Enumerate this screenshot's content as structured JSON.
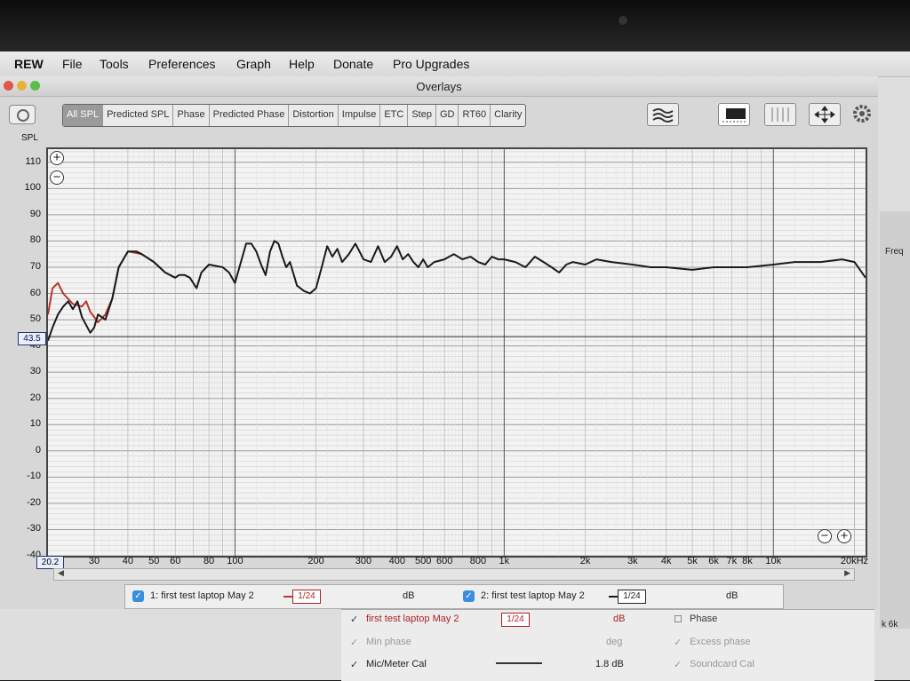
{
  "menubar": {
    "items": [
      "REW",
      "File",
      "Tools",
      "Preferences",
      "Graph",
      "Help",
      "Donate",
      "Pro Upgrades"
    ]
  },
  "window": {
    "title": "Overlays"
  },
  "toolbar": {
    "tabs": [
      "All SPL",
      "Predicted SPL",
      "Phase",
      "Predicted Phase",
      "Distortion",
      "Impulse",
      "ETC",
      "Step",
      "GD",
      "RT60",
      "Clarity"
    ],
    "active_tab": "All SPL",
    "tool_icons": [
      "waterfall-icon",
      "controls-icon",
      "limits-icon",
      "fit-icon",
      "settings-gear-icon"
    ]
  },
  "side": {
    "freq_label": "Freq",
    "bottom_label": "k 6k"
  },
  "legend": {
    "items": [
      {
        "label": "1: first test laptop May 2",
        "smoothing": "1/24",
        "unit": "dB",
        "color": "#b5382e"
      },
      {
        "label": "2: first test laptop May 2",
        "smoothing": "1/24",
        "unit": "dB",
        "color": "#1a1a1a"
      }
    ]
  },
  "panel": {
    "rows": [
      {
        "label": "first test laptop May 2",
        "smoothing": "1/24",
        "unit": "dB",
        "right": "Phase"
      },
      {
        "label": "Min phase",
        "smoothing": "",
        "unit": "deg",
        "right": "Excess phase"
      },
      {
        "label": "Mic/Meter Cal",
        "smoothing": "",
        "unit": "1.8 dB",
        "right": "Soundcard Cal"
      }
    ]
  },
  "chart_data": {
    "type": "line",
    "ylabel": "SPL",
    "ylim": [
      -40,
      115
    ],
    "xlim": [
      20.2,
      22000
    ],
    "x_scale": "log",
    "y_ticks": [
      110,
      100,
      90,
      80,
      70,
      60,
      50,
      40,
      30,
      20,
      10,
      0,
      -10,
      -20,
      -30,
      -40
    ],
    "x_ticks": [
      {
        "v": 30,
        "label": "30"
      },
      {
        "v": 40,
        "label": "40"
      },
      {
        "v": 50,
        "label": "50"
      },
      {
        "v": 60,
        "label": "60"
      },
      {
        "v": 80,
        "label": "80"
      },
      {
        "v": 100,
        "label": "100"
      },
      {
        "v": 200,
        "label": "200"
      },
      {
        "v": 300,
        "label": "300"
      },
      {
        "v": 400,
        "label": "400"
      },
      {
        "v": 500,
        "label": "500"
      },
      {
        "v": 600,
        "label": "600"
      },
      {
        "v": 800,
        "label": "800"
      },
      {
        "v": 1000,
        "label": "1k"
      },
      {
        "v": 2000,
        "label": "2k"
      },
      {
        "v": 3000,
        "label": "3k"
      },
      {
        "v": 4000,
        "label": "4k"
      },
      {
        "v": 5000,
        "label": "5k"
      },
      {
        "v": 6000,
        "label": "6k"
      },
      {
        "v": 7000,
        "label": "7k"
      },
      {
        "v": 8000,
        "label": "8k"
      },
      {
        "v": 10000,
        "label": "10k"
      },
      {
        "v": 20000,
        "label": "20kHz"
      }
    ],
    "x_start_label": "20.2",
    "cursor_y": 43.5,
    "cursor_label": "43.5",
    "grid": true,
    "series": [
      {
        "name": "1: first test laptop May 2",
        "color": "#b5382e",
        "points": [
          [
            20.2,
            52
          ],
          [
            21,
            62
          ],
          [
            22,
            64
          ],
          [
            23,
            60
          ],
          [
            25,
            56
          ],
          [
            27,
            55
          ],
          [
            28,
            57
          ],
          [
            29,
            53
          ],
          [
            31,
            49
          ],
          [
            33,
            52
          ],
          [
            35,
            58
          ],
          [
            37,
            70
          ],
          [
            40,
            76
          ],
          [
            45,
            75
          ],
          [
            50,
            72
          ],
          [
            55,
            68
          ],
          [
            60,
            66
          ]
        ]
      },
      {
        "name": "2: first test laptop May 2",
        "color": "#1a1a1a",
        "points": [
          [
            20.2,
            42
          ],
          [
            21,
            47
          ],
          [
            22,
            52
          ],
          [
            23,
            55
          ],
          [
            24,
            57
          ],
          [
            25,
            54
          ],
          [
            26,
            57
          ],
          [
            27,
            51
          ],
          [
            29,
            45
          ],
          [
            30,
            47
          ],
          [
            31,
            52
          ],
          [
            33,
            50
          ],
          [
            35,
            58
          ],
          [
            37,
            70
          ],
          [
            40,
            76
          ],
          [
            43,
            76
          ],
          [
            45,
            75
          ],
          [
            50,
            72
          ],
          [
            55,
            68
          ],
          [
            60,
            66
          ],
          [
            62,
            67
          ],
          [
            65,
            67
          ],
          [
            68,
            66
          ],
          [
            72,
            62
          ],
          [
            75,
            68
          ],
          [
            80,
            71
          ],
          [
            90,
            70
          ],
          [
            95,
            68
          ],
          [
            100,
            64
          ],
          [
            110,
            79
          ],
          [
            115,
            79
          ],
          [
            120,
            76
          ],
          [
            125,
            71
          ],
          [
            130,
            67
          ],
          [
            135,
            76
          ],
          [
            140,
            80
          ],
          [
            145,
            79
          ],
          [
            150,
            74
          ],
          [
            155,
            70
          ],
          [
            160,
            72
          ],
          [
            170,
            63
          ],
          [
            180,
            61
          ],
          [
            190,
            60
          ],
          [
            200,
            62
          ],
          [
            210,
            70
          ],
          [
            220,
            78
          ],
          [
            230,
            74
          ],
          [
            240,
            77
          ],
          [
            250,
            72
          ],
          [
            265,
            75
          ],
          [
            280,
            79
          ],
          [
            290,
            76
          ],
          [
            300,
            73
          ],
          [
            320,
            72
          ],
          [
            340,
            78
          ],
          [
            360,
            72
          ],
          [
            380,
            74
          ],
          [
            400,
            78
          ],
          [
            420,
            73
          ],
          [
            440,
            75
          ],
          [
            460,
            72
          ],
          [
            480,
            70
          ],
          [
            500,
            73
          ],
          [
            520,
            70
          ],
          [
            550,
            72
          ],
          [
            600,
            73
          ],
          [
            650,
            75
          ],
          [
            700,
            73
          ],
          [
            750,
            74
          ],
          [
            800,
            72
          ],
          [
            850,
            71
          ],
          [
            900,
            74
          ],
          [
            950,
            73
          ],
          [
            1000,
            73
          ],
          [
            1100,
            72
          ],
          [
            1200,
            70
          ],
          [
            1300,
            74
          ],
          [
            1400,
            72
          ],
          [
            1500,
            70
          ],
          [
            1600,
            68
          ],
          [
            1700,
            71
          ],
          [
            1800,
            72
          ],
          [
            2000,
            71
          ],
          [
            2200,
            73
          ],
          [
            2500,
            72
          ],
          [
            3000,
            71
          ],
          [
            3500,
            70
          ],
          [
            4000,
            70
          ],
          [
            5000,
            69
          ],
          [
            6000,
            70
          ],
          [
            7000,
            70
          ],
          [
            8000,
            70
          ],
          [
            10000,
            71
          ],
          [
            12000,
            72
          ],
          [
            15000,
            72
          ],
          [
            18000,
            73
          ],
          [
            20000,
            72
          ],
          [
            22000,
            66
          ]
        ]
      }
    ]
  }
}
